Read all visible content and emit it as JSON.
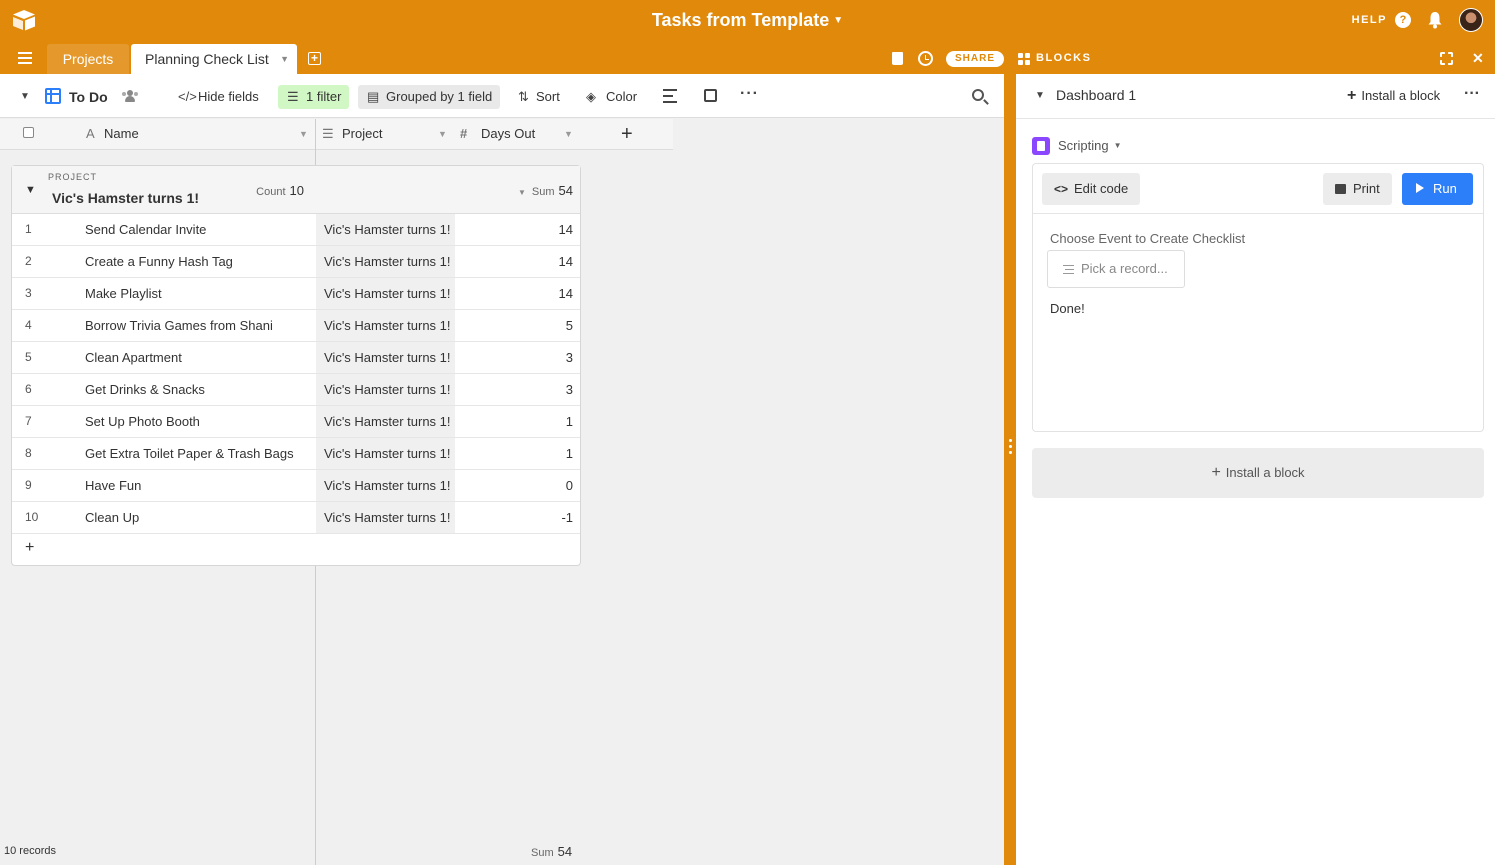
{
  "app": {
    "title": "Tasks from Template",
    "help_label": "HELP",
    "help_icon_glyph": "?",
    "share_label": "SHARE",
    "blocks_label": "BLOCKS",
    "brand_color": "#e1890a"
  },
  "tabs": [
    {
      "label": "Projects"
    },
    {
      "label": "Planning Check List"
    }
  ],
  "viewbar": {
    "view_name": "To Do",
    "hide_fields": "Hide fields",
    "filter": "1 filter",
    "group": "Grouped by 1 field",
    "sort": "Sort",
    "color": "Color"
  },
  "columns": {
    "name": "Name",
    "project": "Project",
    "days_out": "Days Out"
  },
  "group": {
    "label": "PROJECT",
    "title": "Vic's Hamster turns 1!",
    "count_label": "Count",
    "count": "10",
    "sum_label": "Sum",
    "sum": "54"
  },
  "rows": [
    {
      "num": "1",
      "name": "Send Calendar Invite",
      "project": "Vic's Hamster turns 1!",
      "days": "14"
    },
    {
      "num": "2",
      "name": "Create a Funny Hash Tag",
      "project": "Vic's Hamster turns 1!",
      "days": "14"
    },
    {
      "num": "3",
      "name": "Make Playlist",
      "project": "Vic's Hamster turns 1!",
      "days": "14"
    },
    {
      "num": "4",
      "name": "Borrow Trivia Games from Shani",
      "project": "Vic's Hamster turns 1!",
      "days": "5"
    },
    {
      "num": "5",
      "name": "Clean Apartment",
      "project": "Vic's Hamster turns 1!",
      "days": "3"
    },
    {
      "num": "6",
      "name": "Get Drinks & Snacks",
      "project": "Vic's Hamster turns 1!",
      "days": "3"
    },
    {
      "num": "7",
      "name": "Set Up Photo Booth",
      "project": "Vic's Hamster turns 1!",
      "days": "1"
    },
    {
      "num": "8",
      "name": "Get Extra Toilet Paper & Trash Bags",
      "project": "Vic's Hamster turns 1!",
      "days": "1"
    },
    {
      "num": "9",
      "name": "Have Fun",
      "project": "Vic's Hamster turns 1!",
      "days": "0"
    },
    {
      "num": "10",
      "name": "Clean Up",
      "project": "Vic's Hamster turns 1!",
      "days": "-1"
    }
  ],
  "footer": {
    "records": "10 records",
    "sum_label": "Sum",
    "sum": "54"
  },
  "panel": {
    "title": "Dashboard 1",
    "install_label": "Install a block",
    "block_type": "Scripting",
    "edit_code": "Edit code",
    "print": "Print",
    "run": "Run",
    "choose_label": "Choose Event to Create Checklist",
    "pick_placeholder": "Pick a record...",
    "status": "Done!",
    "install_block": "Install a block",
    "run_color": "#2d7ff9",
    "script_color": "#8b46ff"
  }
}
